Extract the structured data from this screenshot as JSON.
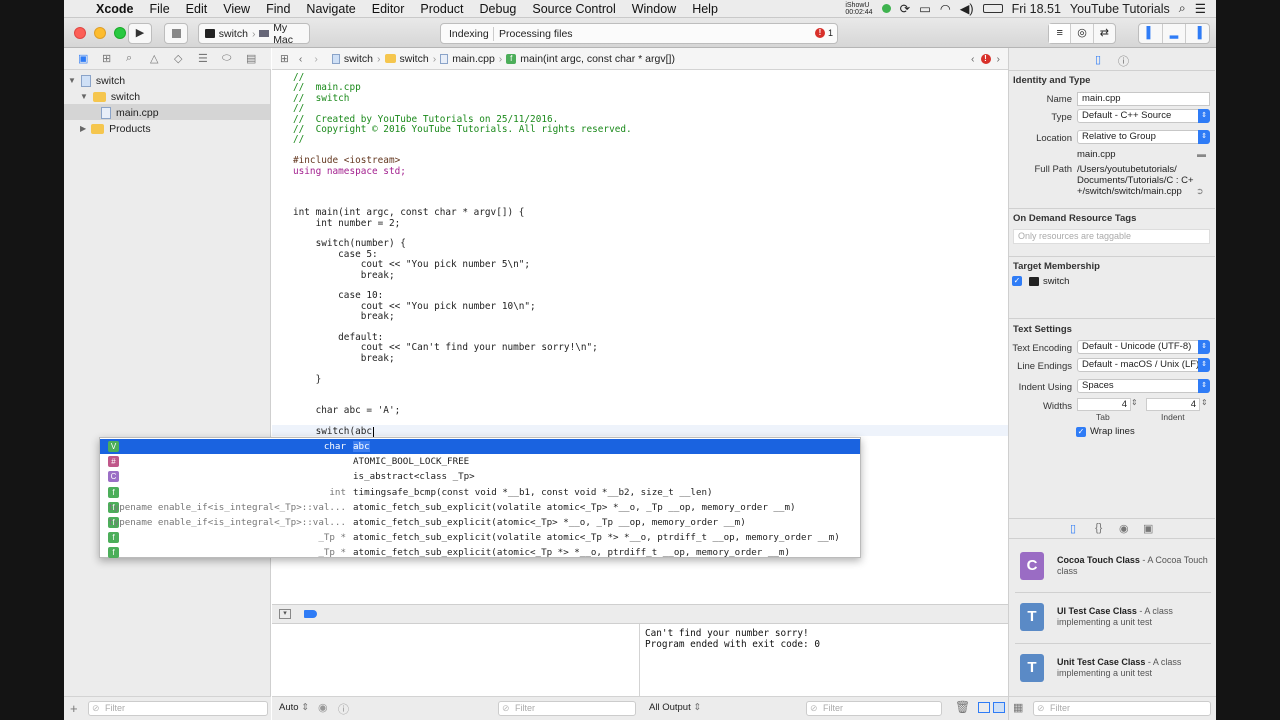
{
  "menubar": {
    "apple": "",
    "items": [
      "Xcode",
      "File",
      "Edit",
      "View",
      "Find",
      "Navigate",
      "Editor",
      "Product",
      "Debug",
      "Source Control",
      "Window",
      "Help"
    ],
    "recorder": "iShowU",
    "recorder_time": "00:02:44",
    "clock": "Fri 18.51",
    "user": "YouTube Tutorials"
  },
  "toolbar": {
    "scheme": "switch",
    "destination": "My Mac",
    "activity_status": "Indexing",
    "activity_detail": "Processing files",
    "error_count": "1"
  },
  "navigator": {
    "items": [
      {
        "label": "switch",
        "kind": "project"
      },
      {
        "label": "switch",
        "kind": "folder"
      },
      {
        "label": "main.cpp",
        "kind": "file"
      },
      {
        "label": "Products",
        "kind": "folder"
      }
    ],
    "filter_placeholder": "Filter"
  },
  "jumpbar": {
    "crumbs": [
      "switch",
      "switch",
      "main.cpp",
      "main(int argc, const char * argv[])"
    ]
  },
  "code": {
    "lines": [
      {
        "t": "//",
        "c": "cm"
      },
      {
        "t": "//  main.cpp",
        "c": "cm"
      },
      {
        "t": "//  switch",
        "c": "cm"
      },
      {
        "t": "//",
        "c": "cm"
      },
      {
        "t": "//  Created by YouTube Tutorials on 25/11/2016.",
        "c": "cm"
      },
      {
        "t": "//  Copyright © 2016 YouTube Tutorials. All rights reserved.",
        "c": "cm"
      },
      {
        "t": "//",
        "c": "cm"
      },
      {
        "t": "",
        "c": ""
      },
      {
        "t": "#include <iostream>",
        "c": "pp"
      },
      {
        "t": "using namespace std;",
        "c": "kw"
      },
      {
        "t": "",
        "c": ""
      },
      {
        "t": "",
        "c": ""
      },
      {
        "t": "",
        "c": ""
      },
      {
        "t": "int main(int argc, const char * argv[]) {",
        "c": ""
      },
      {
        "t": "    int number = 2;",
        "c": ""
      },
      {
        "t": "",
        "c": ""
      },
      {
        "t": "    switch(number) {",
        "c": ""
      },
      {
        "t": "        case 5:",
        "c": ""
      },
      {
        "t": "            cout << \"You pick number 5\\n\";",
        "c": ""
      },
      {
        "t": "            break;",
        "c": ""
      },
      {
        "t": "",
        "c": ""
      },
      {
        "t": "        case 10:",
        "c": ""
      },
      {
        "t": "            cout << \"You pick number 10\\n\";",
        "c": ""
      },
      {
        "t": "            break;",
        "c": ""
      },
      {
        "t": "",
        "c": ""
      },
      {
        "t": "        default:",
        "c": ""
      },
      {
        "t": "            cout << \"Can't find your number sorry!\\n\";",
        "c": ""
      },
      {
        "t": "            break;",
        "c": ""
      },
      {
        "t": "",
        "c": ""
      },
      {
        "t": "    }",
        "c": ""
      },
      {
        "t": "",
        "c": ""
      },
      {
        "t": "",
        "c": ""
      },
      {
        "t": "    char abc = 'A';",
        "c": ""
      },
      {
        "t": "",
        "c": ""
      },
      {
        "t": "    switch(abc",
        "c": ""
      }
    ]
  },
  "autocomplete": [
    {
      "badge": "V",
      "color": "#4cae5a",
      "type": "char",
      "name": "abc",
      "selected": true
    },
    {
      "badge": "#",
      "color": "#c0578a",
      "type": "",
      "name": "ATOMIC_BOOL_LOCK_FREE",
      "selected": false
    },
    {
      "badge": "C",
      "color": "#9b6fc6",
      "type": "",
      "name": "is_abstract<class _Tp>",
      "selected": false
    },
    {
      "badge": "f",
      "color": "#4cae5a",
      "type": "int",
      "name": "timingsafe_bcmp(const void *__b1, const void *__b2, size_t __len)",
      "selected": false
    },
    {
      "badge": "f",
      "color": "#4cae5a",
      "type": "typename enable_if<is_integral<_Tp>::val...",
      "name": "atomic_fetch_sub_explicit(volatile atomic<_Tp> *__o, _Tp __op, memory_order __m)",
      "selected": false
    },
    {
      "badge": "f",
      "color": "#4cae5a",
      "type": "typename enable_if<is_integral<_Tp>::val...",
      "name": "atomic_fetch_sub_explicit(atomic<_Tp> *__o, _Tp __op, memory_order __m)",
      "selected": false
    },
    {
      "badge": "f",
      "color": "#4cae5a",
      "type": "_Tp *",
      "name": "atomic_fetch_sub_explicit(volatile atomic<_Tp *> *__o, ptrdiff_t __op, memory_order __m)",
      "selected": false
    },
    {
      "badge": "f",
      "color": "#4cae5a",
      "type": "_Tp *",
      "name": "atomic_fetch_sub_explicit(atomic<_Tp *> *__o, ptrdiff_t __op, memory_order __m)",
      "selected": false
    }
  ],
  "console": {
    "output": "Can't find your number sorry!\nProgram ended with exit code: 0",
    "auto_label": "Auto",
    "all_output_label": "All Output",
    "filter_placeholder": "Filter"
  },
  "inspector": {
    "identity_header": "Identity and Type",
    "name_label": "Name",
    "name_value": "main.cpp",
    "type_label": "Type",
    "type_value": "Default - C++ Source",
    "location_label": "Location",
    "location_value": "Relative to Group",
    "location_file": "main.cpp",
    "fullpath_label": "Full Path",
    "fullpath_value": "/Users/youtubetutorials/\nDocuments/Tutorials/C : C+\n+/switch/switch/main.cpp",
    "ondemand_header": "On Demand Resource Tags",
    "ondemand_placeholder": "Only resources are taggable",
    "target_header": "Target Membership",
    "target_name": "switch",
    "text_header": "Text Settings",
    "encoding_label": "Text Encoding",
    "encoding_value": "Default - Unicode (UTF-8)",
    "endings_label": "Line Endings",
    "endings_value": "Default - macOS / Unix (LF)",
    "indent_label": "Indent Using",
    "indent_value": "Spaces",
    "widths_label": "Widths",
    "tab_value": "4",
    "indent_width_value": "4",
    "tab_label": "Tab",
    "indent_sub_label": "Indent",
    "wrap_label": "Wrap lines"
  },
  "library": [
    {
      "letter": "C",
      "color": "#9a6cc4",
      "title": "Cocoa Touch Class",
      "desc": " - A Cocoa Touch class"
    },
    {
      "letter": "T",
      "color": "#5a8ac6",
      "title": "UI Test Case Class",
      "desc": " - A class implementing a unit test"
    },
    {
      "letter": "T",
      "color": "#5a8ac6",
      "title": "Unit Test Case Class",
      "desc": " - A class implementing a unit test"
    }
  ],
  "library_filter_placeholder": "Filter"
}
